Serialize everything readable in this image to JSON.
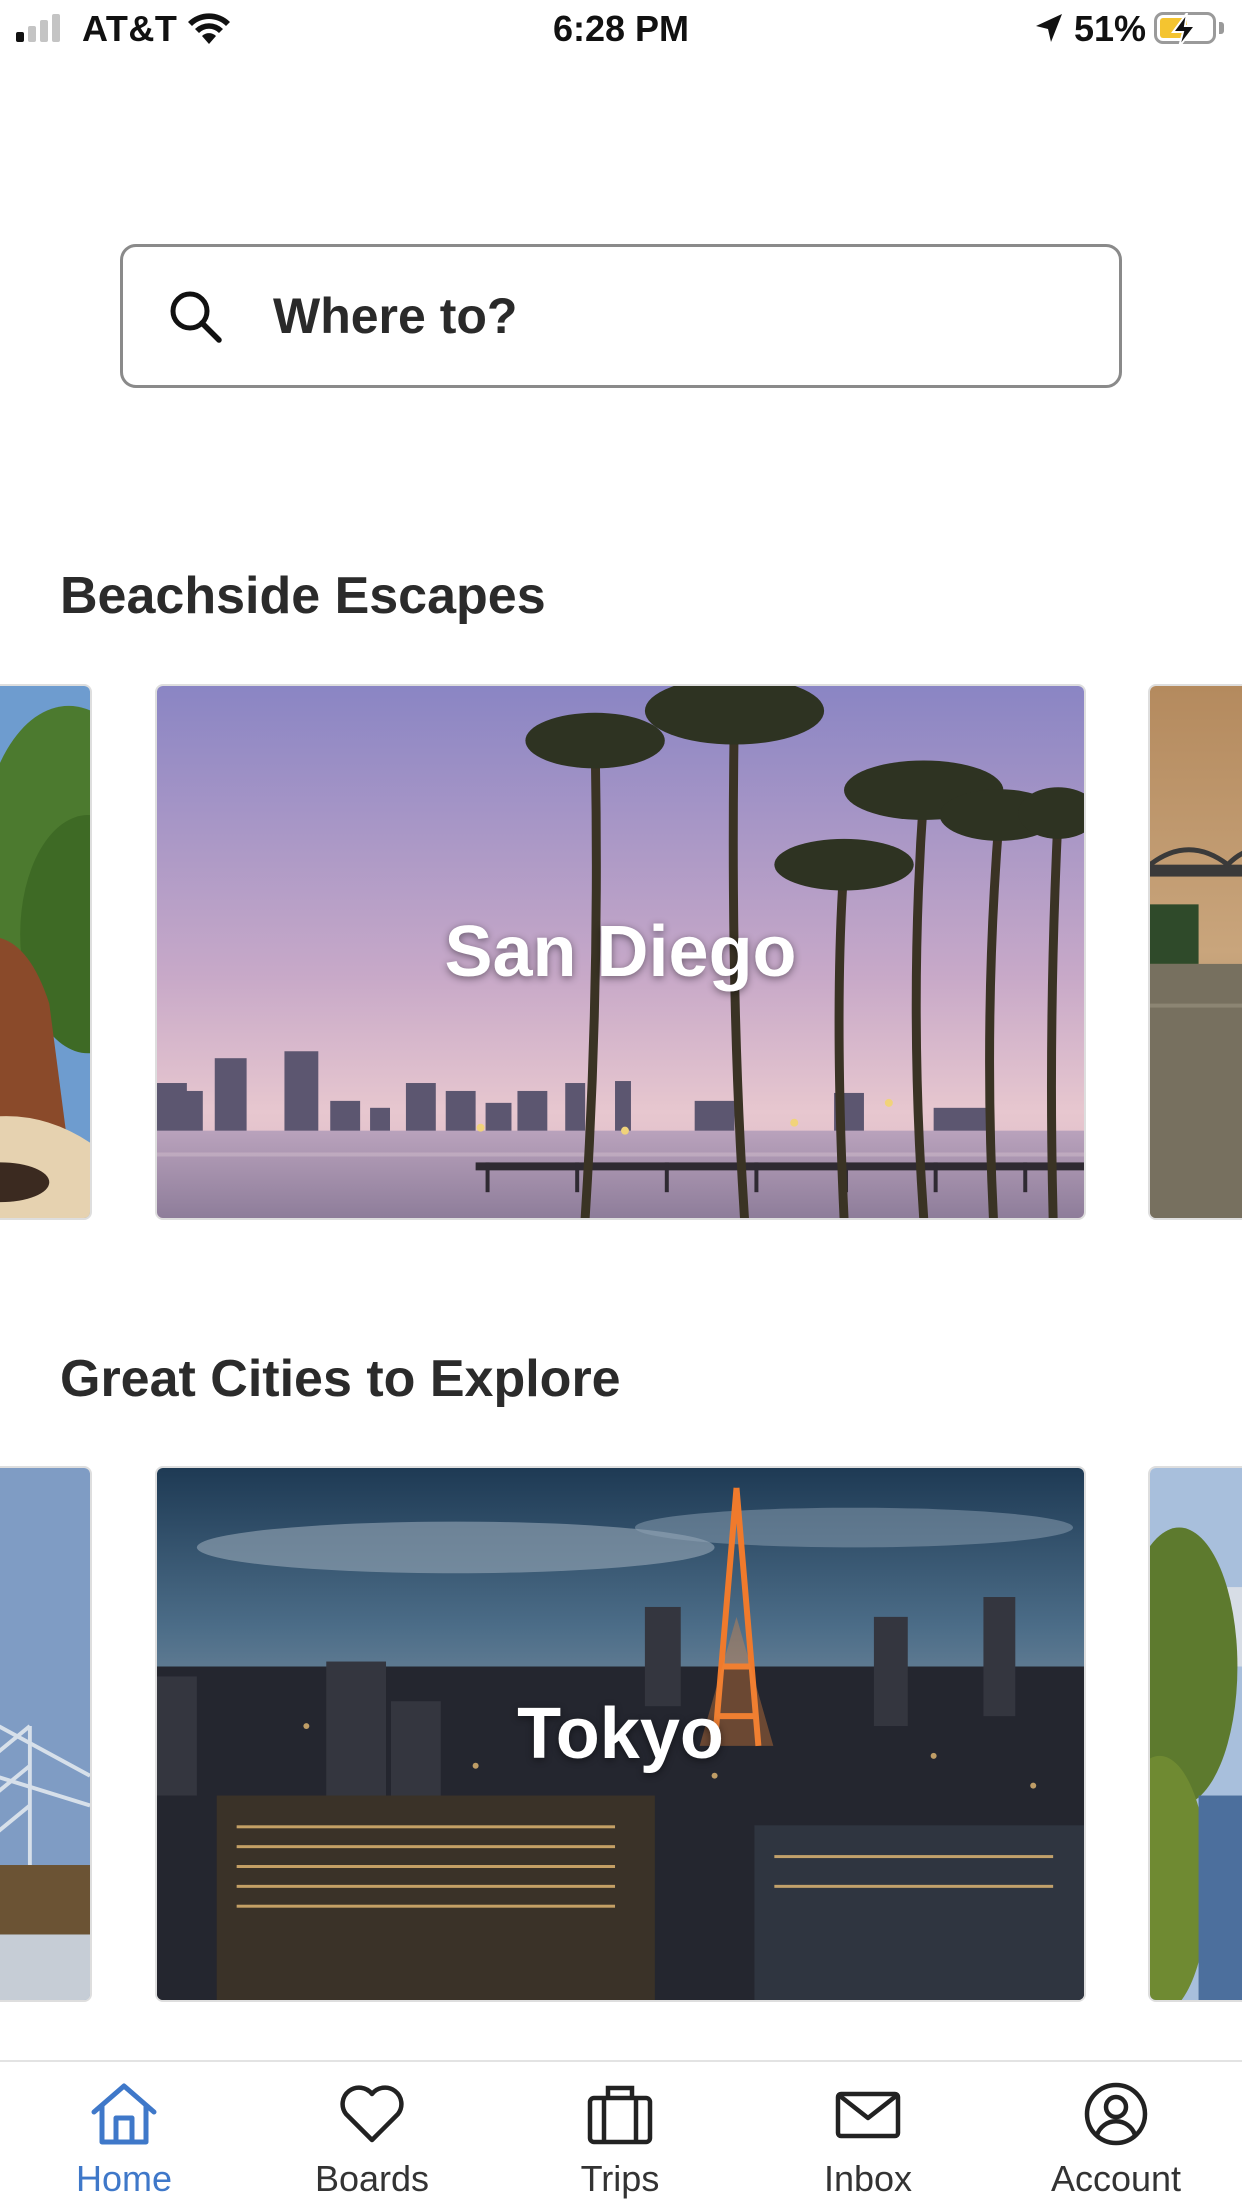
{
  "status_bar": {
    "carrier": "AT&T",
    "time": "6:28 PM",
    "battery": "51%"
  },
  "search": {
    "placeholder": "Where to?"
  },
  "sections": [
    {
      "title": "Beachside Escapes",
      "featured": "San Diego"
    },
    {
      "title": "Great Cities to Explore",
      "featured": "Tokyo"
    }
  ],
  "tabs": [
    {
      "label": "Home",
      "icon": "home-icon",
      "active": true
    },
    {
      "label": "Boards",
      "icon": "heart-icon"
    },
    {
      "label": "Trips",
      "icon": "suitcase-icon"
    },
    {
      "label": "Inbox",
      "icon": "envelope-icon"
    },
    {
      "label": "Account",
      "icon": "user-circle-icon"
    }
  ],
  "colors": {
    "accent": "#3f78c9",
    "text": "#2b2b2b",
    "border": "#8a8a8a"
  }
}
